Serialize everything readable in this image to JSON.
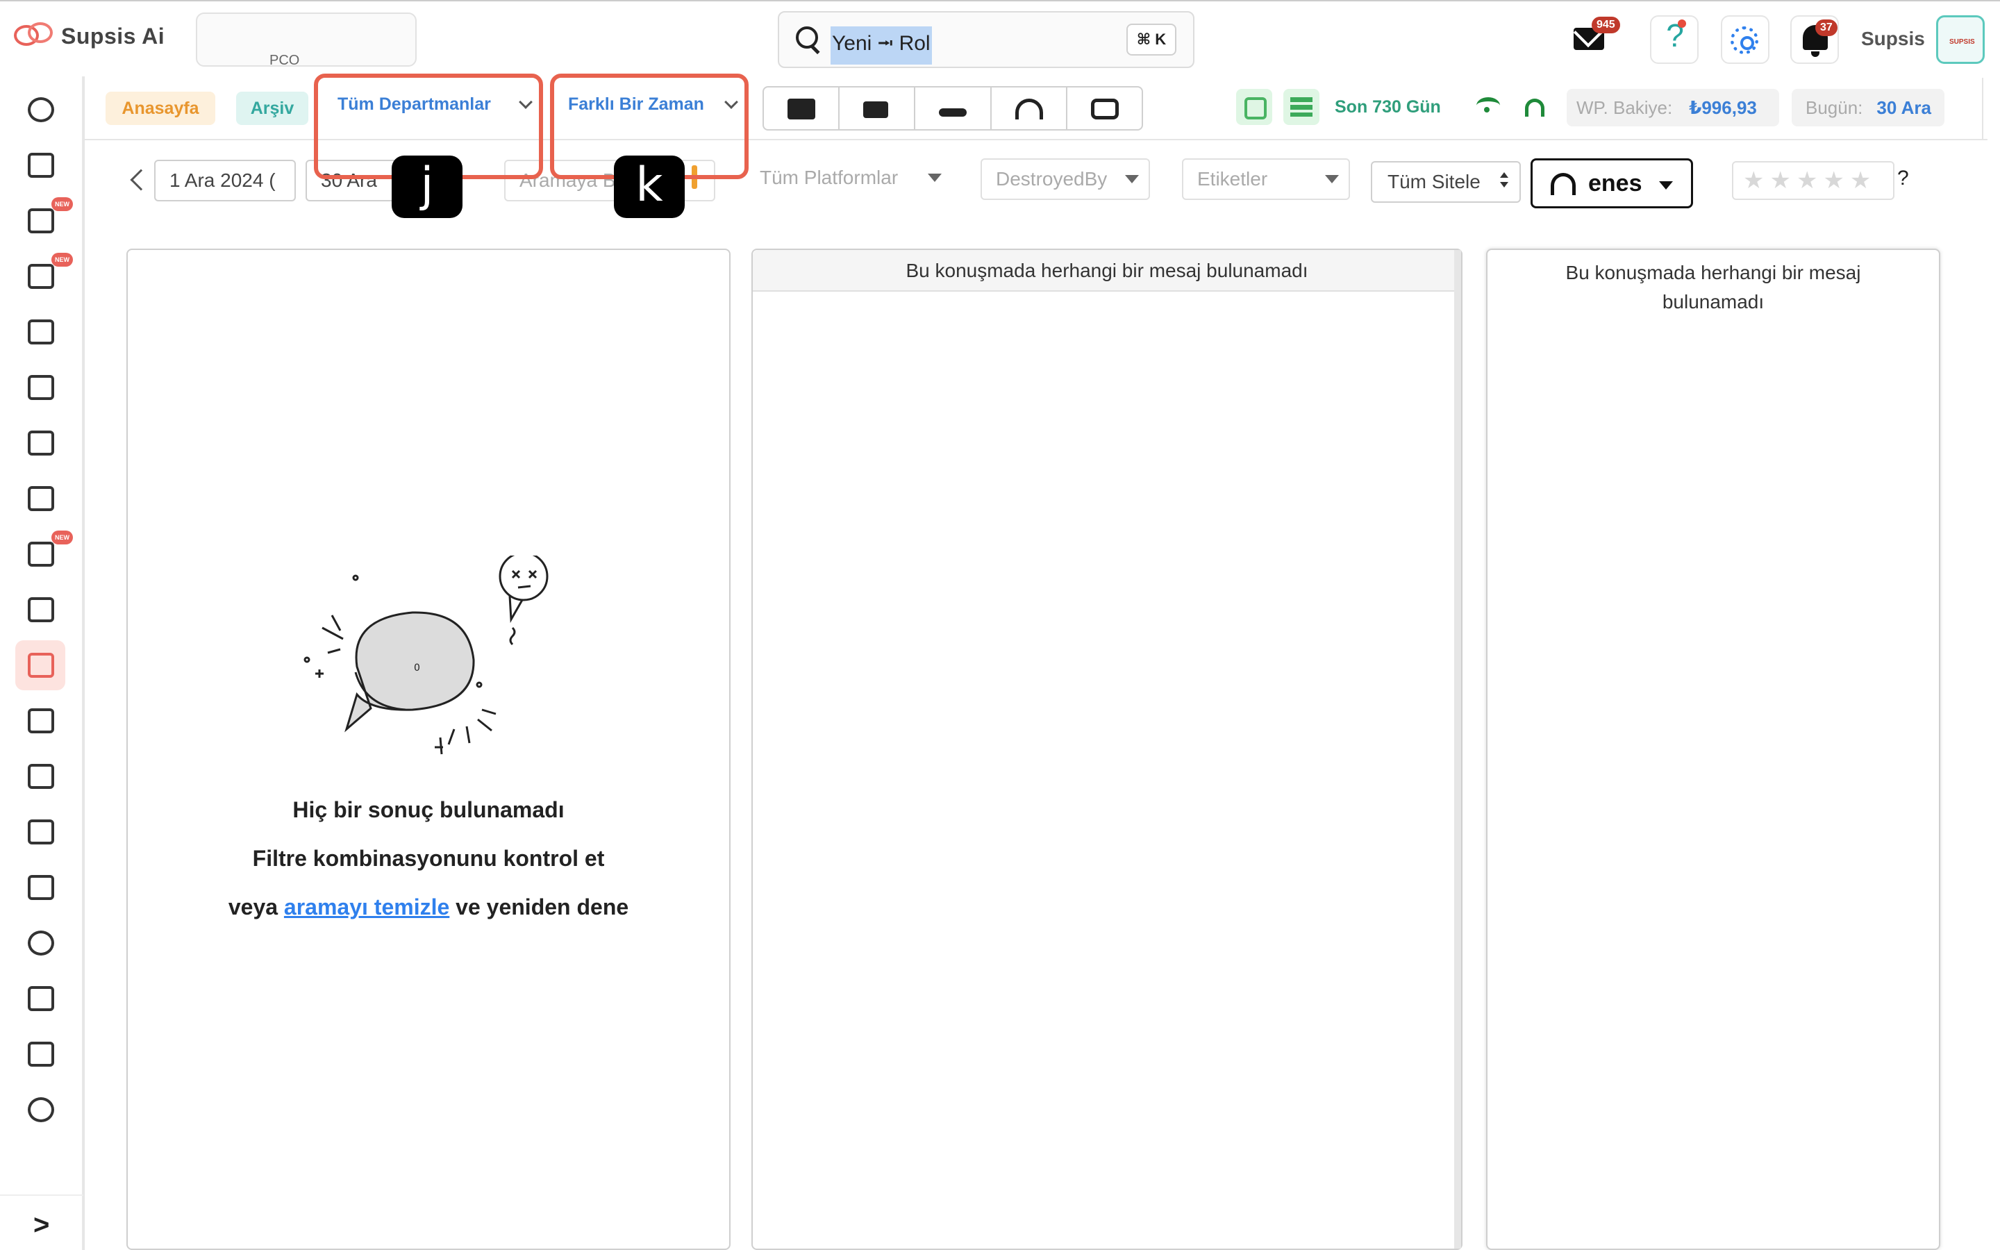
{
  "app": {
    "name": "Supsis Ai",
    "workspace_label": "PCO"
  },
  "search": {
    "value": "Yeni ⭲ Rol",
    "shortcut": "⌘ K"
  },
  "header": {
    "mail_count": "945",
    "notification_count": "37",
    "user_name": "Supsis",
    "avatar_text": "SUPSIS"
  },
  "sidebar": {
    "items": [
      {
        "icon": "chat-bubble-icon"
      },
      {
        "icon": "robot-icon"
      },
      {
        "icon": "flower-icon",
        "badge": "NEW"
      },
      {
        "icon": "table-icon",
        "badge": "NEW"
      },
      {
        "icon": "contact-card-icon"
      },
      {
        "icon": "mail-icon"
      },
      {
        "icon": "calendar-icon"
      },
      {
        "icon": "list-icon"
      },
      {
        "icon": "edit-list-icon",
        "badge": "NEW"
      },
      {
        "icon": "ticket-icon"
      },
      {
        "icon": "inbox-icon",
        "active": true
      },
      {
        "icon": "users-icon"
      },
      {
        "icon": "pen-icon"
      },
      {
        "icon": "lightning-icon"
      },
      {
        "icon": "grid-icon"
      },
      {
        "icon": "gear-icon"
      },
      {
        "icon": "share-icon"
      },
      {
        "icon": "payment-icon"
      },
      {
        "icon": "pie-chart-icon"
      }
    ],
    "collapse_label": ">"
  },
  "filters": {
    "home_chip": "Anasayfa",
    "archive_chip": "Arşiv",
    "department": "Tüm Departmanlar",
    "time": "Farklı Bir Zaman",
    "channels": [
      "chat-icon",
      "video-icon",
      "missed-call-icon",
      "headset-icon",
      "bot-icon"
    ],
    "period": "Son 730 Gün",
    "wp_balance_label": "WP. Bakiye:",
    "wp_balance_value": "₺996,93",
    "today_label": "Bugün:",
    "today_value": "30 Ara"
  },
  "annotations": {
    "j": "j",
    "k": "k"
  },
  "row2": {
    "start_date": "1 Ara 2024 (",
    "end_date": "30 Ara",
    "search_placeholder": "Aramaya B",
    "platforms": "Tüm Platformlar",
    "destroyed_by": "DestroyedBy",
    "tags": "Etiketler",
    "sites": "Tüm Sitele",
    "agent": "enes",
    "rating_stars": "★★★★★",
    "rating_help": "?"
  },
  "panels": {
    "empty_title": "Hiç bir sonuç bulunamadı",
    "empty_hint": "Filtre kombinasyonunu kontrol et",
    "empty_prefix": "veya",
    "empty_link": "aramayı temizle",
    "empty_suffix": "ve yeniden dene",
    "bubble_count": "0",
    "middle_message": "Bu konuşmada herhangi bir mesaj bulunamadı",
    "right_message": "Bu konuşmada herhangi bir mesaj bulunamadı"
  },
  "colors": {
    "accent": "#e8625a",
    "link": "#2f80ed",
    "brand_teal": "#34a89f"
  }
}
